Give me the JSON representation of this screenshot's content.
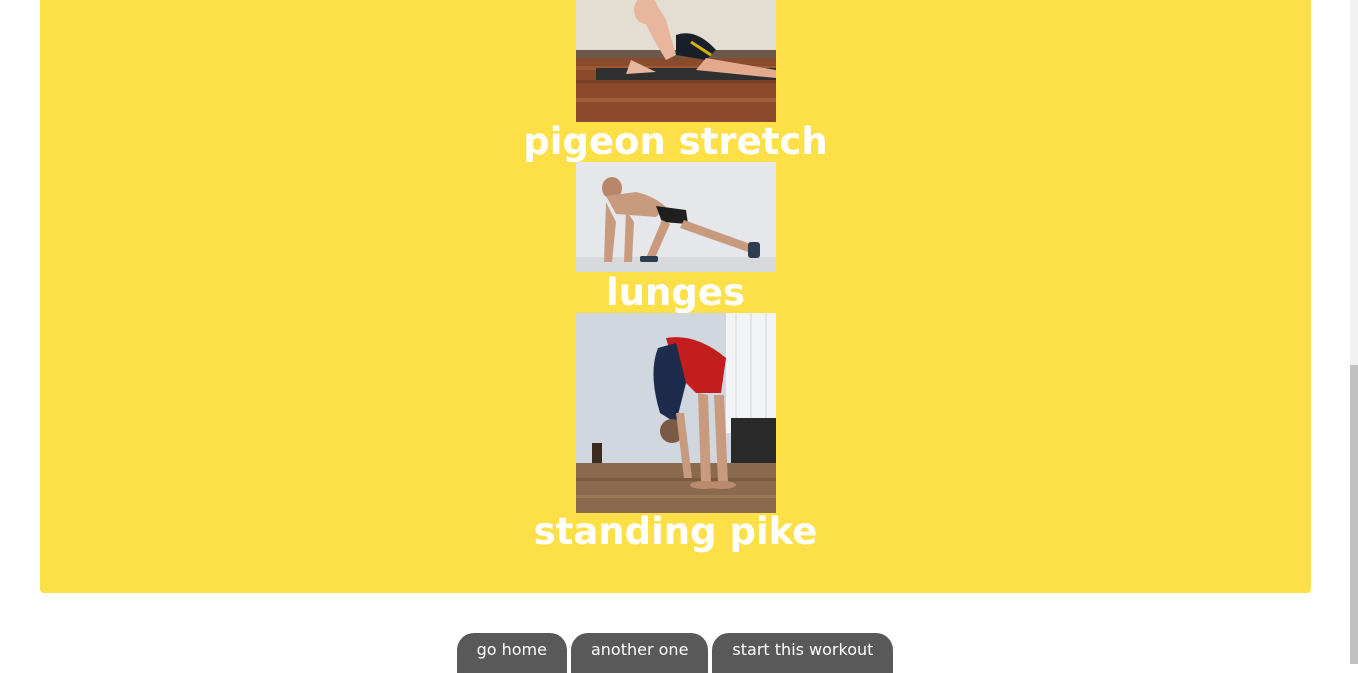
{
  "exercises": [
    {
      "name": "pigeon stretch",
      "image_icon": "pigeon-stretch-photo"
    },
    {
      "name": "lunges",
      "image_icon": "lunges-photo"
    },
    {
      "name": "standing pike",
      "image_icon": "standing-pike-photo"
    }
  ],
  "buttons": {
    "go_home": "go home",
    "another_one": "another one",
    "start_workout": "start this workout"
  },
  "colors": {
    "card_background": "#fddf47",
    "title_text": "#ffffff",
    "button_background": "#595959"
  }
}
